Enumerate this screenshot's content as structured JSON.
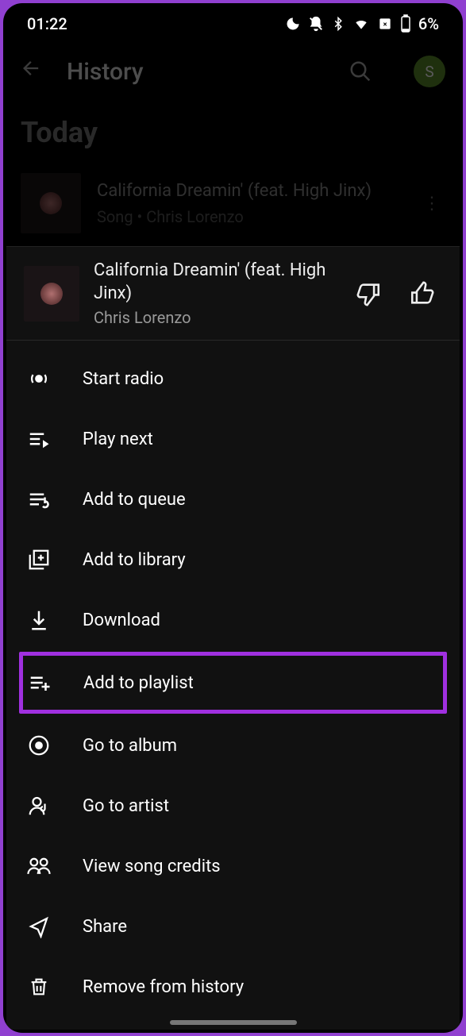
{
  "status": {
    "time": "01:22",
    "battery": "6%"
  },
  "header": {
    "title": "History",
    "avatar_letter": "S"
  },
  "section": "Today",
  "history_item": {
    "title": "California Dreamin' (feat. High Jinx)",
    "subtitle": "Song • Chris Lorenzo"
  },
  "sheet": {
    "title": "California Dreamin' (feat. High Jinx)",
    "artist": "Chris Lorenzo",
    "menu": {
      "start_radio": "Start radio",
      "play_next": "Play next",
      "add_queue": "Add to queue",
      "add_library": "Add to library",
      "download": "Download",
      "add_playlist": "Add to playlist",
      "go_album": "Go to album",
      "go_artist": "Go to artist",
      "song_credits": "View song credits",
      "share": "Share",
      "remove_history": "Remove from history"
    }
  }
}
